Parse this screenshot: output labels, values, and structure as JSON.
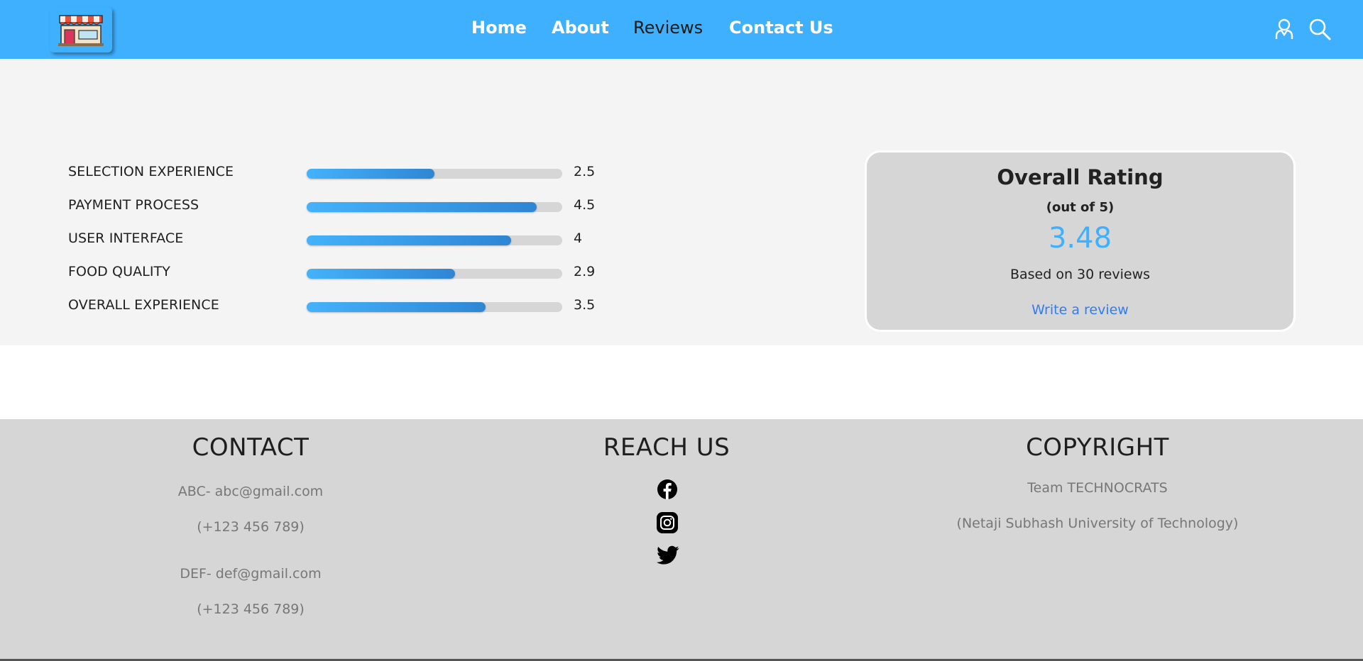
{
  "header": {
    "logo_name": "store-logo",
    "nav": [
      {
        "label": "Home",
        "active": false
      },
      {
        "label": "About",
        "active": false
      },
      {
        "label": "Reviews",
        "active": true
      },
      {
        "label": "Contact Us",
        "active": false
      }
    ],
    "icons": [
      "user-icon",
      "search-icon"
    ],
    "background_color": "#3fb0fd"
  },
  "ratings": {
    "max": 5,
    "items": [
      {
        "label": "SELECTION EXPERIENCE",
        "value": "2.5",
        "fill_fraction": 0.5
      },
      {
        "label": "PAYMENT PROCESS",
        "value": "4.5",
        "fill_fraction": 0.9
      },
      {
        "label": "USER INTERFACE",
        "value": "4",
        "fill_fraction": 0.8
      },
      {
        "label": "FOOD QUALITY",
        "value": "2.9",
        "fill_fraction": 0.58
      },
      {
        "label": "OVERALL EXPERIENCE",
        "value": "3.5",
        "fill_fraction": 0.7
      }
    ],
    "bar_color": "#3fb0fd",
    "track_color": "#d6d6d6"
  },
  "overall": {
    "title": "Overall Rating",
    "subtitle": "(out of 5)",
    "score": "3.48",
    "based_on": "Based on 30 reviews",
    "write_review": "Write a review",
    "score_color": "#3fb0fd",
    "link_color": "#2f7df0"
  },
  "footer": {
    "contact": {
      "heading": "CONTACT",
      "lines": [
        "ABC- abc@gmail.com",
        "(+123 456 789)",
        "DEF- def@gmail.com",
        "(+123 456 789)"
      ]
    },
    "reach": {
      "heading": "REACH US",
      "icons": [
        "facebook-icon",
        "instagram-icon",
        "twitter-icon"
      ]
    },
    "copyright": {
      "heading": "COPYRIGHT",
      "lines": [
        "Team TECHNOCRATS",
        "(Netaji Subhash University of Technology)"
      ]
    }
  }
}
